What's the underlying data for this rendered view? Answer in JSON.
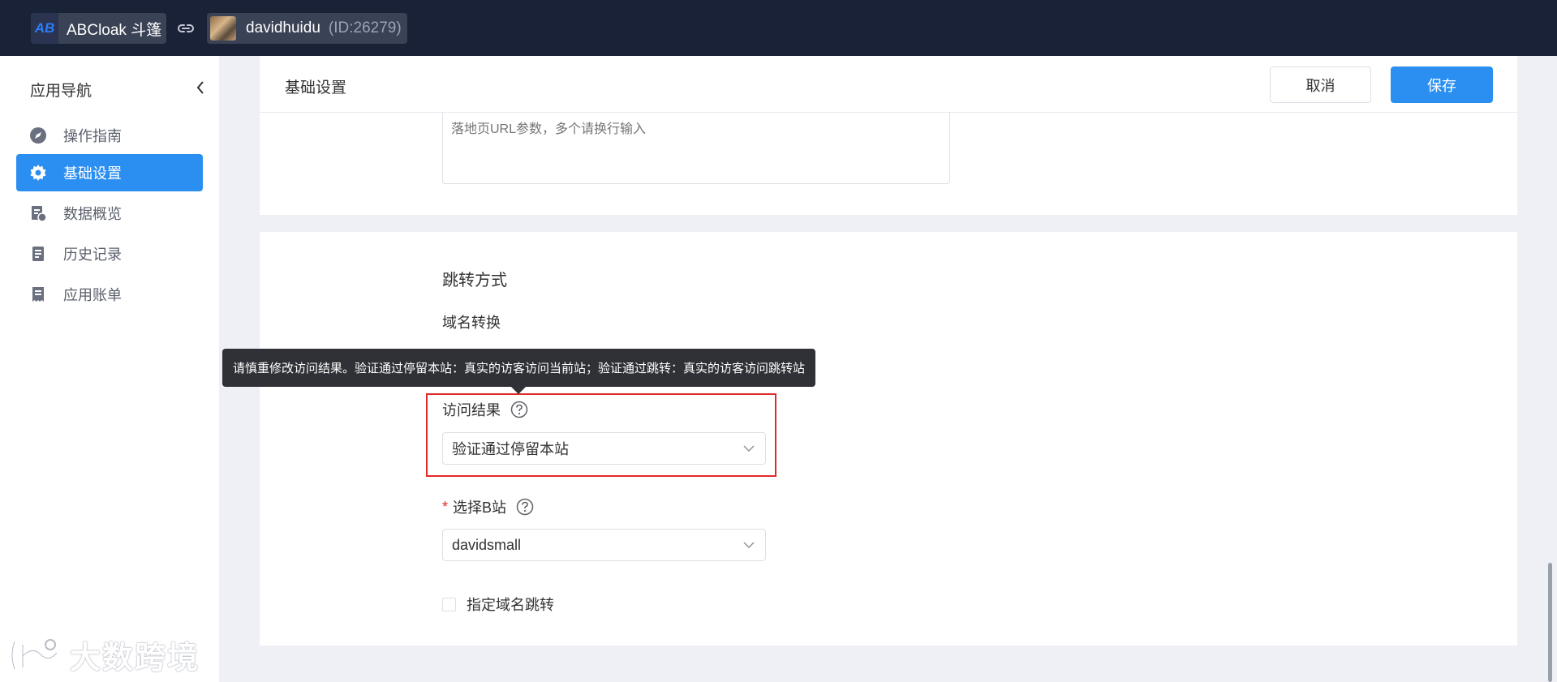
{
  "topbar": {
    "brand_logo": "AB",
    "brand_name": "ABCloak 斗篷",
    "link_icon": "link-icon",
    "account_name": "davidhuidu",
    "account_id": "(ID:26279)"
  },
  "sidebar": {
    "title": "应用导航",
    "items": [
      {
        "label": "操作指南",
        "icon": "compass-icon",
        "active": false
      },
      {
        "label": "基础设置",
        "icon": "gear-icon",
        "active": true
      },
      {
        "label": "数据概览",
        "icon": "data-report-icon",
        "active": false
      },
      {
        "label": "历史记录",
        "icon": "document-icon",
        "active": false
      },
      {
        "label": "应用账单",
        "icon": "bill-icon",
        "active": false
      }
    ]
  },
  "watermark": {
    "text": "大数跨境"
  },
  "header": {
    "title": "基础设置",
    "cancel_label": "取消",
    "save_label": "保存"
  },
  "landing_params": {
    "placeholder": "落地页URL参数，多个请换行输入"
  },
  "redirect": {
    "section_title": "跳转方式",
    "domain_conversion": "域名转换",
    "tooltip": "请慎重修改访问结果。验证通过停留本站：真实的访客访问当前站；验证通过跳转：真实的访客访问跳转站",
    "visit_result_label": "访问结果",
    "visit_result_value": "验证通过停留本站",
    "select_b_label": "选择B站",
    "select_b_required": "*",
    "select_b_value": "davidsmall",
    "specify_domain_label": "指定域名跳转",
    "specify_domain_checked": false
  },
  "colors": {
    "topbar_bg": "#1a2238",
    "primary": "#2b8ff2",
    "highlight_border": "#e02a2a",
    "tooltip_bg": "#2f3136"
  }
}
